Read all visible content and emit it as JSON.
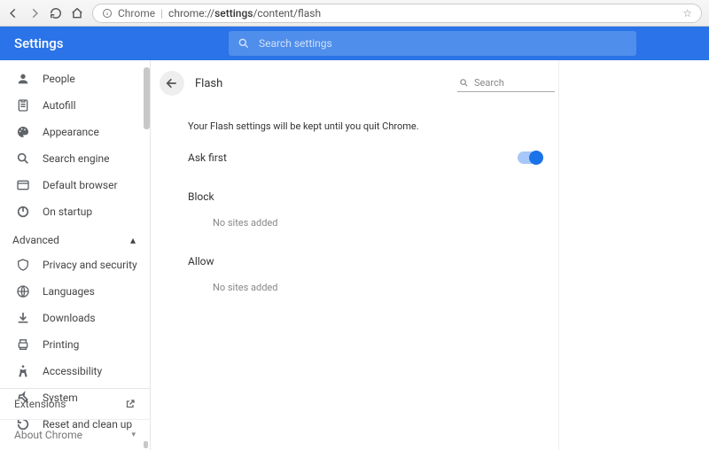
{
  "browser": {
    "label": "Chrome",
    "url_prefix": "chrome://",
    "url_bold": "settings",
    "url_rest": "/content/flash"
  },
  "header": {
    "title": "Settings",
    "search_placeholder": "Search settings"
  },
  "sidebar": {
    "basic": [
      {
        "label": "People",
        "icon": "person"
      },
      {
        "label": "Autofill",
        "icon": "clipboard"
      },
      {
        "label": "Appearance",
        "icon": "palette"
      },
      {
        "label": "Search engine",
        "icon": "search"
      },
      {
        "label": "Default browser",
        "icon": "browser"
      },
      {
        "label": "On startup",
        "icon": "power"
      }
    ],
    "advanced_label": "Advanced",
    "advanced": [
      {
        "label": "Privacy and security",
        "icon": "shield"
      },
      {
        "label": "Languages",
        "icon": "globe"
      },
      {
        "label": "Downloads",
        "icon": "download"
      },
      {
        "label": "Printing",
        "icon": "print"
      },
      {
        "label": "Accessibility",
        "icon": "accessibility"
      },
      {
        "label": "System",
        "icon": "wrench"
      },
      {
        "label": "Reset and clean up",
        "icon": "restore"
      }
    ],
    "extensions": "Extensions",
    "about": "About Chrome"
  },
  "page": {
    "title": "Flash",
    "search_placeholder": "Search",
    "note": "Your Flash settings will be kept until you quit Chrome.",
    "ask_first": "Ask first",
    "ask_first_on": true,
    "block": "Block",
    "block_empty": "No sites added",
    "allow": "Allow",
    "allow_empty": "No sites added"
  }
}
